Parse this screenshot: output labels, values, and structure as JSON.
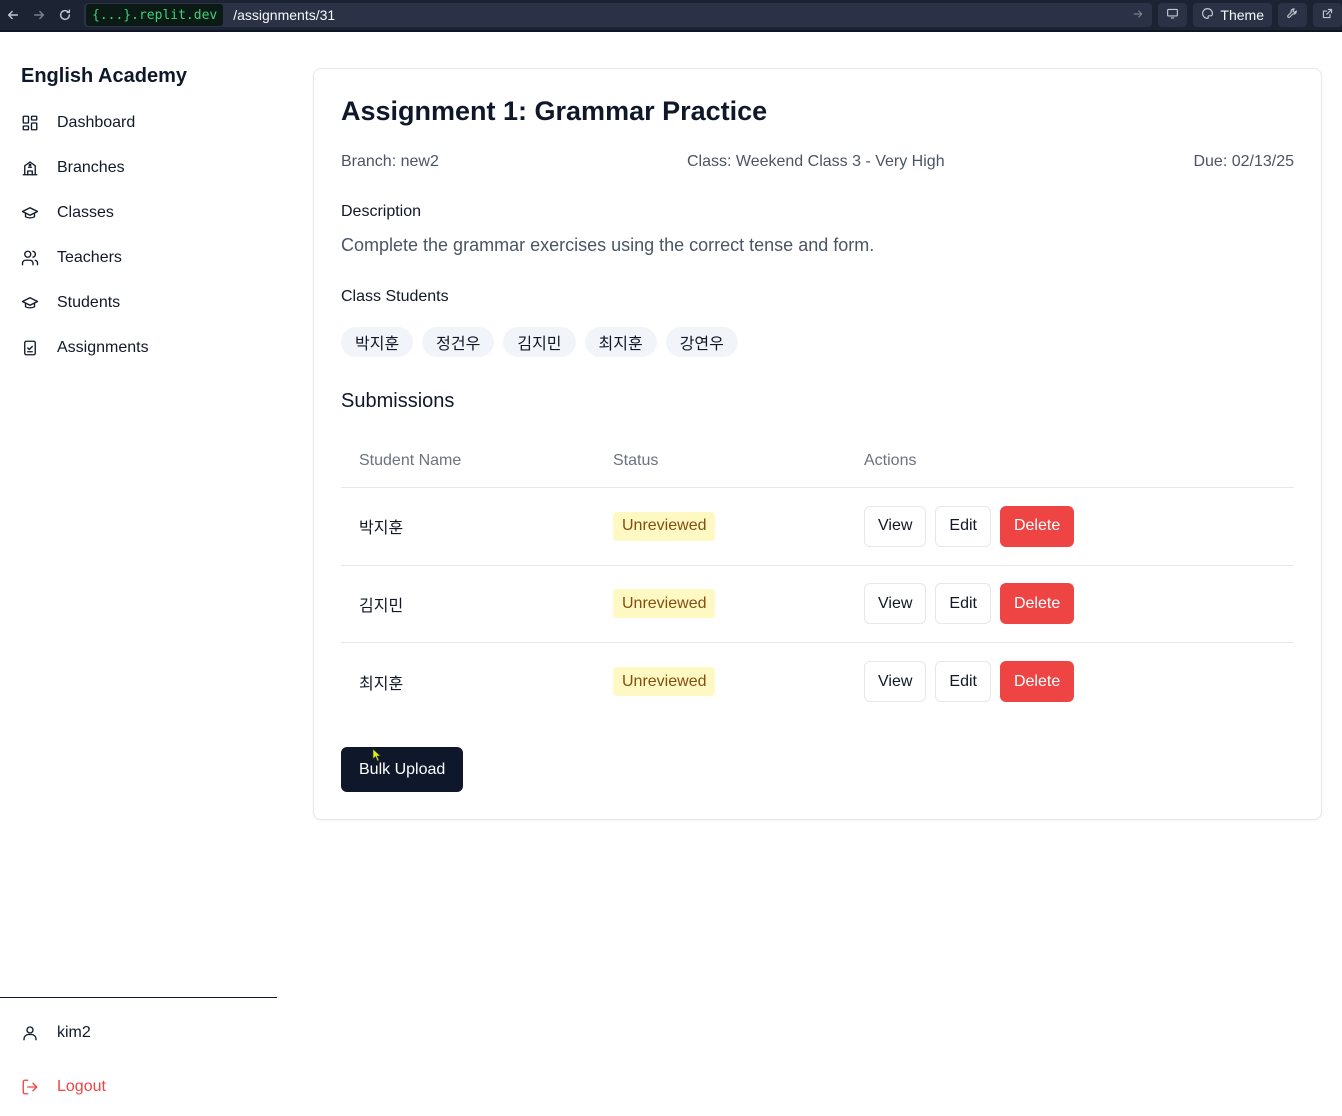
{
  "browser": {
    "domain": "{...}.replit.dev",
    "path": "/assignments/31",
    "theme_label": "Theme",
    "icons": [
      "back-arrow-icon",
      "forward-arrow-icon",
      "reload-icon",
      "go-arrow-icon",
      "monitor-icon",
      "palette-icon",
      "wrench-icon",
      "external-link-icon"
    ]
  },
  "sidebar": {
    "brand": "English Academy",
    "items": [
      {
        "label": "Dashboard",
        "icon": "dashboard-icon"
      },
      {
        "label": "Branches",
        "icon": "building-icon"
      },
      {
        "label": "Classes",
        "icon": "graduation-cap-icon"
      },
      {
        "label": "Teachers",
        "icon": "users-icon"
      },
      {
        "label": "Students",
        "icon": "graduation-cap-icon"
      },
      {
        "label": "Assignments",
        "icon": "clipboard-check-icon"
      }
    ],
    "user": "kim2",
    "logout": "Logout"
  },
  "assignment": {
    "title": "Assignment 1: Grammar Practice",
    "branch": "Branch: new2",
    "class": "Class: Weekend Class 3 - Very High",
    "due": "Due: 02/13/25",
    "description_label": "Description",
    "description": "Complete the grammar exercises using the correct tense and form.",
    "students_label": "Class Students",
    "students": [
      "박지훈",
      "정건우",
      "김지민",
      "최지훈",
      "강연우"
    ]
  },
  "submissions": {
    "title": "Submissions",
    "columns": [
      "Student Name",
      "Status",
      "Actions"
    ],
    "rows": [
      {
        "name": "박지훈",
        "status": "Unreviewed"
      },
      {
        "name": "김지민",
        "status": "Unreviewed"
      },
      {
        "name": "최지훈",
        "status": "Unreviewed"
      }
    ],
    "view_label": "View",
    "edit_label": "Edit",
    "delete_label": "Delete",
    "bulk_upload_label": "Bulk Upload"
  },
  "colors": {
    "primary": "#0f172a",
    "danger": "#ef4444",
    "badge_bg": "#fef9c3",
    "badge_text": "#854d0e",
    "replit_green": "#3fd07a"
  }
}
